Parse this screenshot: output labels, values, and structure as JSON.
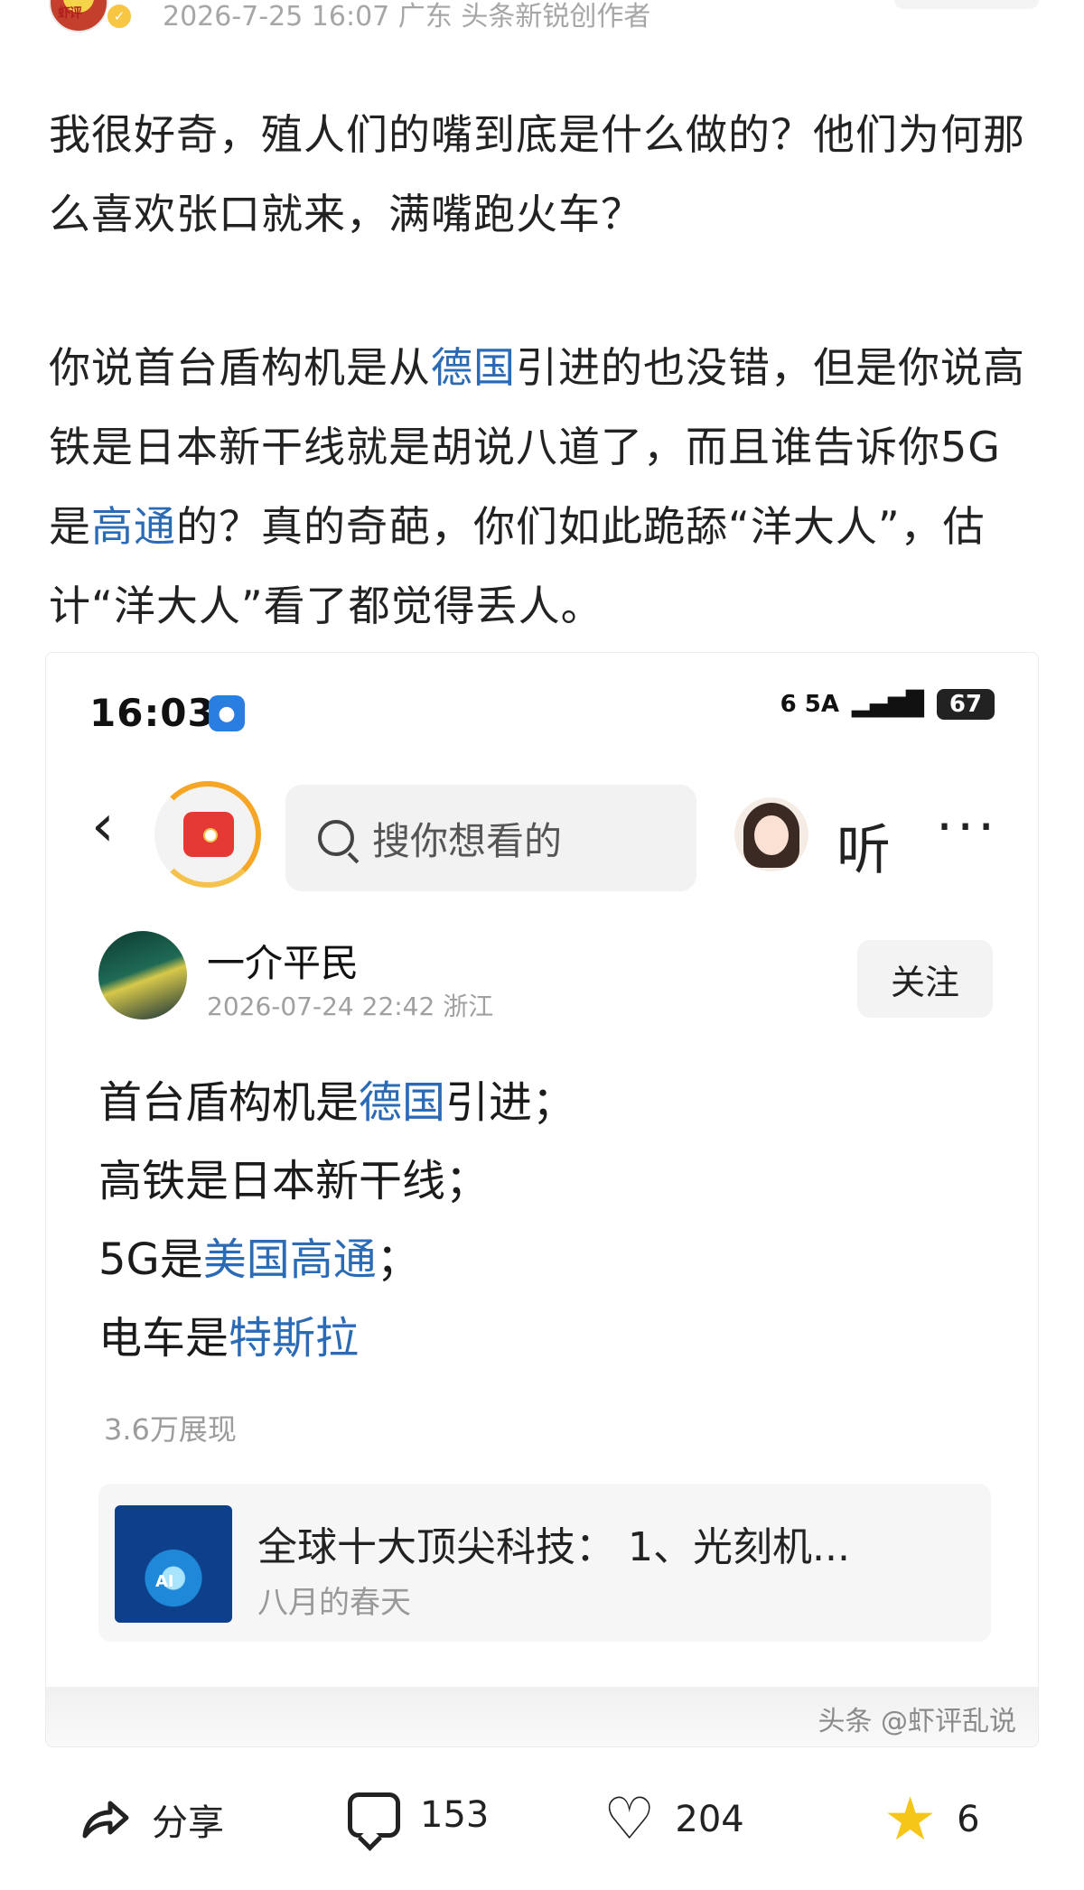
{
  "header": {
    "meta": "2026-7-25 16:07 广东 头条新锐创作者",
    "avatar_text": "虾评"
  },
  "article": {
    "p1": "我很好奇，殖人们的嘴到底是什么做的？他们为何那么喜欢张口就来，满嘴跑火车？",
    "p2_a": "你说首台盾构机是从",
    "p2_hl1": "德国",
    "p2_b": "引进的也没错，但是你说高铁是日本新干线就是胡说八道了，而且谁告诉你5G是",
    "p2_hl2": "高通",
    "p2_c": "的？真的奇葩，你们如此跪舔“洋大人”，估计“洋大人”看了都觉得丢人。"
  },
  "screenshot": {
    "time": "16:03",
    "signal_text": "6 5A",
    "battery": "67",
    "search_placeholder": "搜你想看的",
    "listen_label": "听",
    "more_label": "···",
    "author_name": "一介平民",
    "author_time": "2026-07-24 22:42 浙江",
    "follow_label": "关注",
    "post": {
      "l1_a": "首台盾构机是",
      "l1_hl": "德国",
      "l1_b": "引进；",
      "l2": "高铁是日本新干线；",
      "l3_a": "5G是",
      "l3_hl": "美国高通",
      "l3_b": "；",
      "l4_a": "电车是",
      "l4_hl": "特斯拉"
    },
    "views": "3.6万展现",
    "rec_title": "全球十大顶尖科技： 1、光刻机...",
    "rec_sub": "八月的春天",
    "rec_thumb_text": "AI",
    "watermark": "头条 @虾评乱说"
  },
  "actions": {
    "share_label": "分享",
    "comments": "153",
    "likes": "204",
    "favorites": "6"
  },
  "colors": {
    "link": "#2b6bb6",
    "meta_gray": "#a6a6a6",
    "star": "#f5c518"
  }
}
